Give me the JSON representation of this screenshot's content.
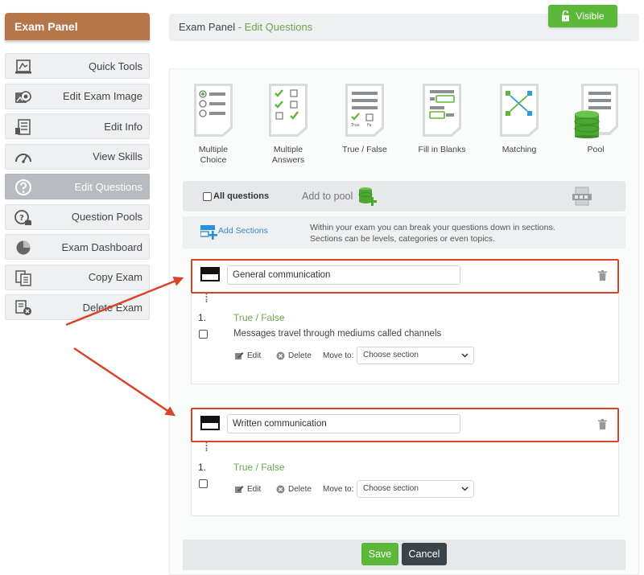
{
  "sidebar": {
    "title": "Exam Panel",
    "items": [
      {
        "label": "Quick Tools",
        "icon": "quick-tools-icon"
      },
      {
        "label": "Edit Exam Image",
        "icon": "image-icon"
      },
      {
        "label": "Edit Info",
        "icon": "info-icon"
      },
      {
        "label": "View Skills",
        "icon": "gauge-icon"
      },
      {
        "label": "Edit Questions",
        "icon": "question-icon",
        "active": true
      },
      {
        "label": "Question Pools",
        "icon": "pool-icon"
      },
      {
        "label": "Exam Dashboard",
        "icon": "dashboard-icon"
      },
      {
        "label": "Copy Exam",
        "icon": "copy-icon"
      },
      {
        "label": "Delete Exam",
        "icon": "delete-icon"
      }
    ]
  },
  "breadcrumb": {
    "root": "Exam Panel",
    "separator": " - ",
    "current": "Edit Questions"
  },
  "visibility": {
    "label": "Visible",
    "icon": "unlock-icon"
  },
  "question_types": [
    {
      "label": "Multiple\nChoice",
      "icon": "multiple-choice-icon"
    },
    {
      "label": "Multiple\nAnswers",
      "icon": "multiple-answers-icon"
    },
    {
      "label": "True / False",
      "icon": "true-false-icon",
      "mini_true": "True",
      "mini_false": "Fa"
    },
    {
      "label": "Fill in Blanks",
      "icon": "fill-blanks-icon"
    },
    {
      "label": "Matching",
      "icon": "matching-icon"
    },
    {
      "label": "Pool",
      "icon": "pool-database-icon"
    }
  ],
  "toolbar": {
    "all_questions": "All questions",
    "add_to_pool": "Add to pool"
  },
  "sections_bar": {
    "add_sections": "Add Sections",
    "info_line1": "Within your exam you can break your questions down in sections.",
    "info_line2": "Sections can be levels, categories or even topics."
  },
  "sections": [
    {
      "name": "General communication",
      "question": {
        "number": "1.",
        "type": "True / False",
        "text": "Messages travel through mediums called channels",
        "edit": "Edit",
        "delete": "Delete",
        "move_to": "Move to:",
        "select": "Choose section"
      }
    },
    {
      "name": "Written communication",
      "question": {
        "number": "1.",
        "type": "True / False",
        "text": "",
        "edit": "Edit",
        "delete": "Delete",
        "move_to": "Move to:",
        "select": "Choose section"
      }
    }
  ],
  "footer": {
    "save": "Save",
    "cancel": "Cancel"
  },
  "colors": {
    "brand": "#b5764a",
    "accent": "#5cb838",
    "highlight": "#d9432a",
    "link": "#3b86c4"
  }
}
